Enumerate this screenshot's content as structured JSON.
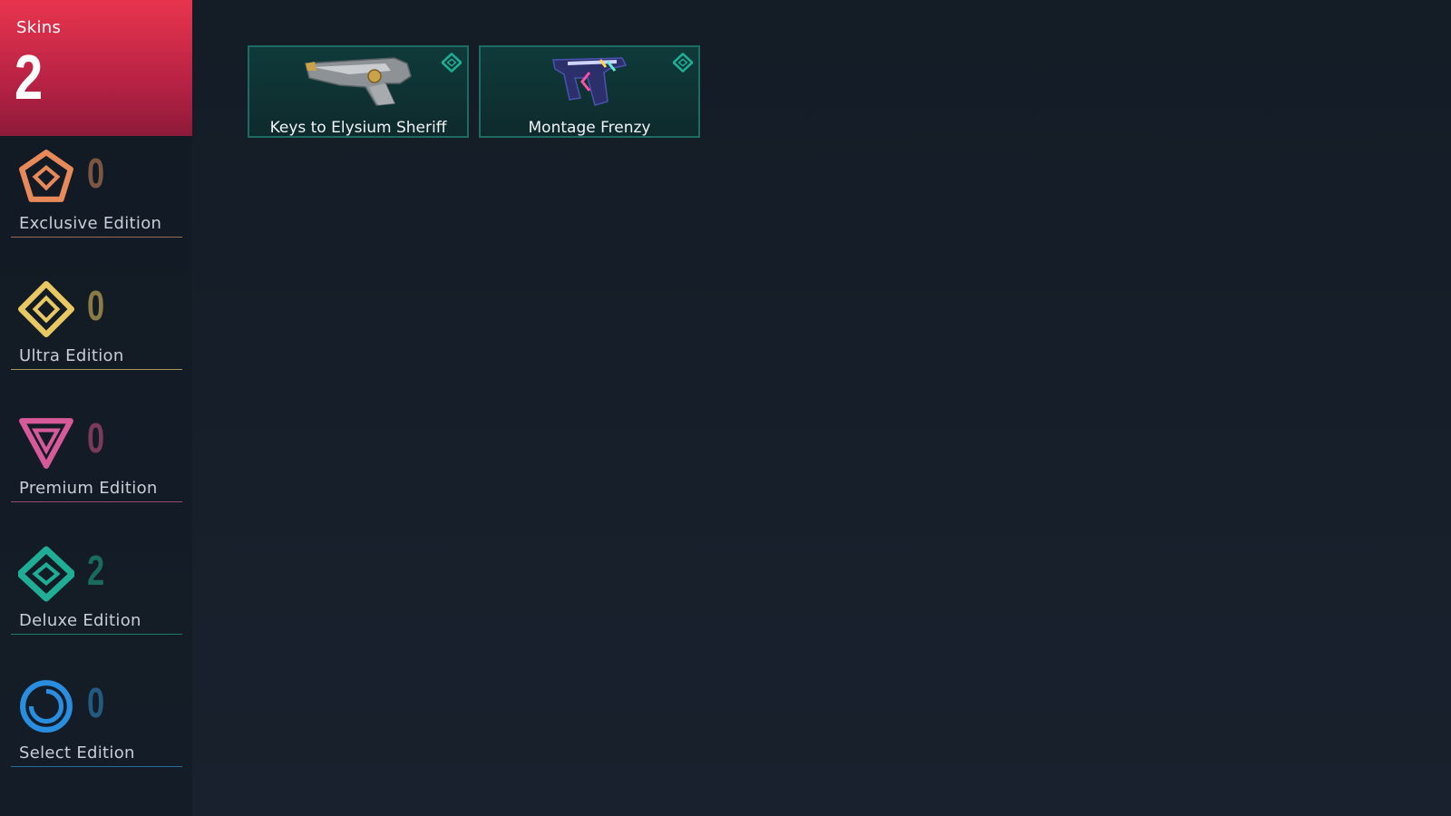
{
  "skins_panel": {
    "title": "Skins",
    "count": "2"
  },
  "editions": [
    {
      "label": "Exclusive Edition",
      "count": "0",
      "icon": "exclusive-edition-icon",
      "color": "#e8895a",
      "count_color": "#7a5643",
      "line_color": "#9a6a55"
    },
    {
      "label": "Ultra Edition",
      "count": "0",
      "icon": "ultra-edition-icon",
      "color": "#e8c862",
      "count_color": "#8a7a45",
      "line_color": "#a89560"
    },
    {
      "label": "Premium Edition",
      "count": "0",
      "icon": "premium-edition-icon",
      "color": "#d65a9a",
      "count_color": "#7a3a58",
      "line_color": "#9a4a70"
    },
    {
      "label": "Deluxe Edition",
      "count": "2",
      "icon": "deluxe-edition-icon",
      "color": "#1fae95",
      "count_color": "#1b6a5e",
      "line_color": "#1f7a6b"
    },
    {
      "label": "Select Edition",
      "count": "0",
      "icon": "select-edition-icon",
      "color": "#2a8ee0",
      "count_color": "#225a80",
      "line_color": "#2a6a98"
    }
  ],
  "skins": [
    {
      "name": "Keys to Elysium Sheriff",
      "tier_icon": "deluxe-edition-icon",
      "image": "sheriff-weapon-image"
    },
    {
      "name": "Montage Frenzy",
      "tier_icon": "deluxe-edition-icon",
      "image": "frenzy-weapon-image"
    }
  ]
}
